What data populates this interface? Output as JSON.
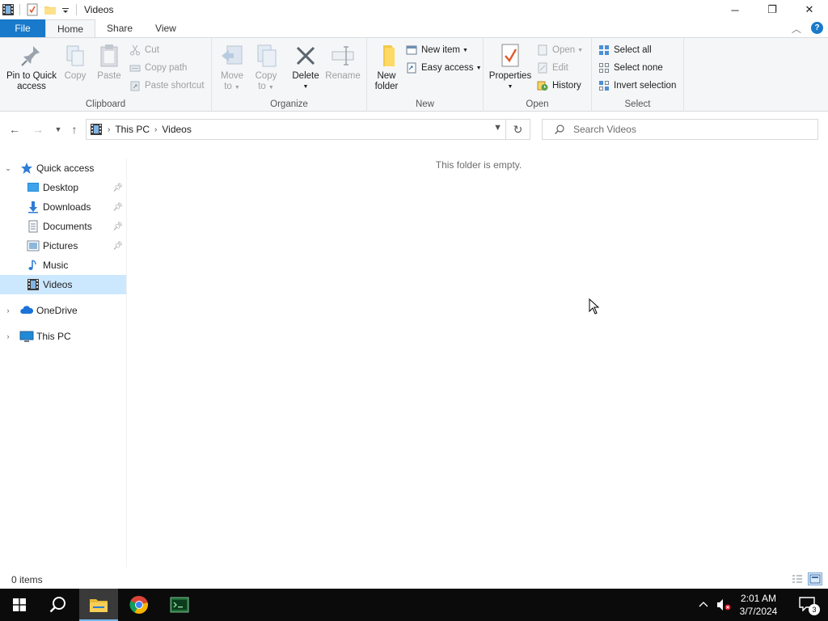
{
  "window": {
    "title": "Videos",
    "controls": {
      "minimize": "─",
      "restore": "❐",
      "close": "✕"
    }
  },
  "ribbon_tabs": [
    {
      "label": "File"
    },
    {
      "label": "Home"
    },
    {
      "label": "Share"
    },
    {
      "label": "View"
    }
  ],
  "ribbon": {
    "clipboard": {
      "group_label": "Clipboard",
      "pin": "Pin to Quick access",
      "pin_line1": "Pin to Quick",
      "pin_line2": "access",
      "copy": "Copy",
      "paste": "Paste",
      "cut": "Cut",
      "copy_path": "Copy path",
      "paste_shortcut": "Paste shortcut"
    },
    "organize": {
      "group_label": "Organize",
      "move_to_line1": "Move",
      "move_to_line2": "to",
      "copy_to_line1": "Copy",
      "copy_to_line2": "to",
      "delete": "Delete",
      "rename": "Rename"
    },
    "new": {
      "group_label": "New",
      "new_folder_line1": "New",
      "new_folder_line2": "folder",
      "new_item": "New item",
      "easy_access": "Easy access"
    },
    "open": {
      "group_label": "Open",
      "properties": "Properties",
      "open": "Open",
      "edit": "Edit",
      "history": "History"
    },
    "select": {
      "group_label": "Select",
      "select_all": "Select all",
      "select_none": "Select none",
      "invert_selection": "Invert selection"
    }
  },
  "address": {
    "breadcrumb": [
      "This PC",
      "Videos"
    ],
    "search_placeholder": "Search Videos"
  },
  "nav_pane": {
    "quick_access": "Quick access",
    "items": [
      {
        "label": "Desktop",
        "pinned": true
      },
      {
        "label": "Downloads",
        "pinned": true
      },
      {
        "label": "Documents",
        "pinned": true
      },
      {
        "label": "Pictures",
        "pinned": true
      },
      {
        "label": "Music",
        "pinned": false
      },
      {
        "label": "Videos",
        "pinned": false,
        "selected": true
      }
    ],
    "onedrive": "OneDrive",
    "this_pc": "This PC"
  },
  "content": {
    "empty_message": "This folder is empty."
  },
  "status_bar": {
    "item_count": "0 items"
  },
  "taskbar": {
    "apps": [
      "start",
      "search",
      "file-explorer",
      "chrome",
      "terminal-app"
    ],
    "active_app": "file-explorer",
    "time": "2:01 AM",
    "date": "3/7/2024",
    "notification_count": "3"
  },
  "colors": {
    "accent": "#1979ca",
    "selection": "#cce8ff",
    "taskbar": "#0b0b0b"
  }
}
